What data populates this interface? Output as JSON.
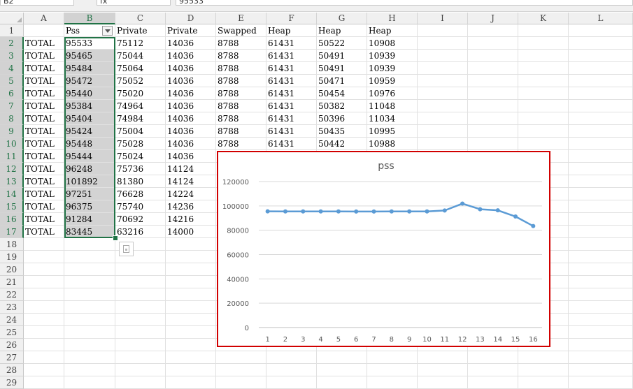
{
  "toolbar": {
    "name_box": "B2",
    "fx_label": "fx",
    "formula_value": "95533"
  },
  "sheet": {
    "columns": [
      "A",
      "B",
      "C",
      "D",
      "E",
      "F",
      "G",
      "H",
      "I",
      "J",
      "K",
      "L"
    ],
    "row_numbers": [
      1,
      2,
      3,
      4,
      5,
      6,
      7,
      8,
      9,
      10,
      11,
      12,
      13,
      14,
      15,
      16,
      17,
      18,
      19,
      20,
      21,
      22,
      23,
      24,
      25,
      26,
      27,
      28,
      29
    ],
    "header_row": [
      "",
      "Pss",
      "Private",
      "Private",
      "Swapped",
      "Heap",
      "Heap",
      "Heap"
    ],
    "rows": [
      [
        "TOTAL",
        "95533",
        "75112",
        "14036",
        "8788",
        "61431",
        "50522",
        "10908"
      ],
      [
        "TOTAL",
        "95465",
        "75044",
        "14036",
        "8788",
        "61431",
        "50491",
        "10939"
      ],
      [
        "TOTAL",
        "95484",
        "75064",
        "14036",
        "8788",
        "61431",
        "50491",
        "10939"
      ],
      [
        "TOTAL",
        "95472",
        "75052",
        "14036",
        "8788",
        "61431",
        "50471",
        "10959"
      ],
      [
        "TOTAL",
        "95440",
        "75020",
        "14036",
        "8788",
        "61431",
        "50454",
        "10976"
      ],
      [
        "TOTAL",
        "95384",
        "74964",
        "14036",
        "8788",
        "61431",
        "50382",
        "11048"
      ],
      [
        "TOTAL",
        "95404",
        "74984",
        "14036",
        "8788",
        "61431",
        "50396",
        "11034"
      ],
      [
        "TOTAL",
        "95424",
        "75004",
        "14036",
        "8788",
        "61431",
        "50435",
        "10995"
      ],
      [
        "TOTAL",
        "95448",
        "75028",
        "14036",
        "8788",
        "61431",
        "50442",
        "10988"
      ],
      [
        "TOTAL",
        "95444",
        "75024",
        "14036",
        "",
        "",
        "",
        ""
      ],
      [
        "TOTAL",
        "96248",
        "75736",
        "14124",
        "",
        "",
        "",
        ""
      ],
      [
        "TOTAL",
        "101892",
        "81380",
        "14124",
        "",
        "",
        "",
        ""
      ],
      [
        "TOTAL",
        "97251",
        "76628",
        "14224",
        "",
        "",
        "",
        ""
      ],
      [
        "TOTAL",
        "96375",
        "75740",
        "14236",
        "",
        "",
        "",
        ""
      ],
      [
        "TOTAL",
        "91284",
        "70692",
        "14216",
        "",
        "",
        "",
        ""
      ],
      [
        "TOTAL",
        "83445",
        "63216",
        "14000",
        "",
        "",
        "",
        ""
      ]
    ]
  },
  "chart_data": {
    "type": "line",
    "title": "pss",
    "x": [
      1,
      2,
      3,
      4,
      5,
      6,
      7,
      8,
      9,
      10,
      11,
      12,
      13,
      14,
      15,
      16
    ],
    "series": [
      {
        "values": [
          95533,
          95465,
          95484,
          95472,
          95440,
          95384,
          95404,
          95424,
          95448,
          95444,
          96248,
          101892,
          97251,
          96375,
          91284,
          83445
        ]
      }
    ],
    "yticks": [
      0,
      20000,
      40000,
      60000,
      80000,
      100000,
      120000
    ],
    "ylim": [
      0,
      120000
    ],
    "grid": true,
    "line_color": "#5b9bd5"
  }
}
